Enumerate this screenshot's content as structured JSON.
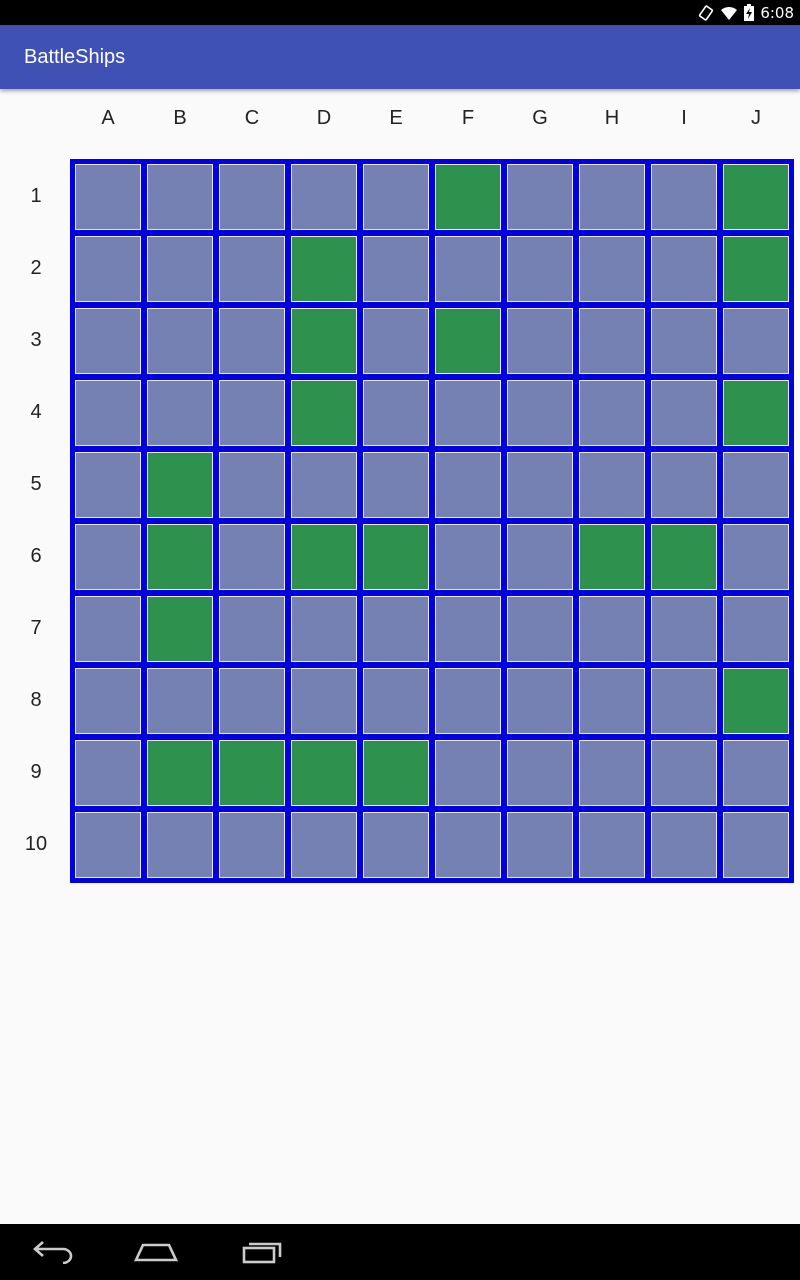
{
  "status_bar": {
    "time": "6:08",
    "icons": [
      "rotation-icon",
      "wifi-icon",
      "battery-charging-icon"
    ]
  },
  "app_bar": {
    "title": "BattleShips",
    "color": "#3f51b5"
  },
  "board": {
    "columns": [
      "A",
      "B",
      "C",
      "D",
      "E",
      "F",
      "G",
      "H",
      "I",
      "J"
    ],
    "rows": [
      "1",
      "2",
      "3",
      "4",
      "5",
      "6",
      "7",
      "8",
      "9",
      "10"
    ],
    "water_color": "#7681b3",
    "ship_color": "#2e914d",
    "grid_color": "#0000e0",
    "ship_cells": [
      "F1",
      "J1",
      "D2",
      "J2",
      "D3",
      "F3",
      "D4",
      "J4",
      "B5",
      "B6",
      "D6",
      "E6",
      "H6",
      "I6",
      "B7",
      "J8",
      "B9",
      "C9",
      "D9",
      "E9"
    ]
  },
  "nav_bar": {
    "buttons": [
      "back-icon",
      "home-icon",
      "recents-icon"
    ]
  }
}
